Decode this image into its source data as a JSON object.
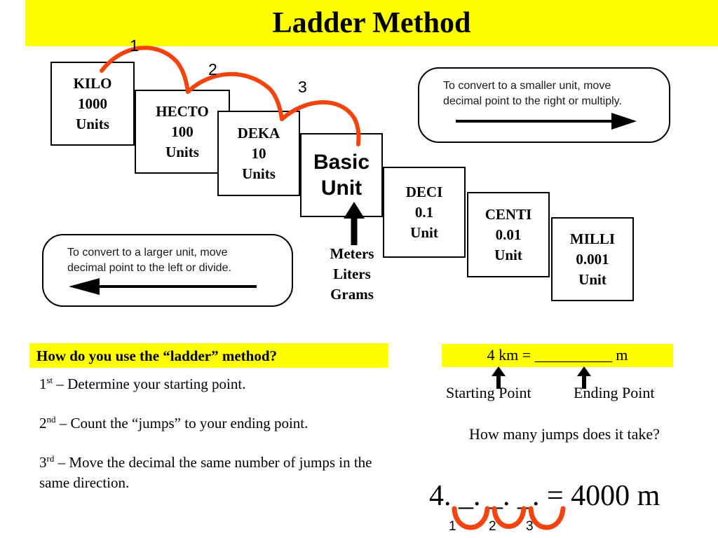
{
  "title": "Ladder Method",
  "colors": {
    "highlight": "#FFFF00",
    "jump_arc": "#F4430C",
    "text": "#000000",
    "background": "#FFFFFF"
  },
  "ladder": {
    "steps": [
      {
        "name": "KILO",
        "value": "1000",
        "unit": "Units"
      },
      {
        "name": "HECTO",
        "value": "100",
        "unit": "Units"
      },
      {
        "name": "DEKA",
        "value": "10",
        "unit": "Units"
      },
      {
        "name": "Basic",
        "value": "Unit",
        "unit": ""
      },
      {
        "name": "DECI",
        "value": "0.1",
        "unit": "Unit"
      },
      {
        "name": "CENTI",
        "value": "0.01",
        "unit": "Unit"
      },
      {
        "name": "MILLI",
        "value": "0.001",
        "unit": "Unit"
      }
    ],
    "jump_labels": [
      "1",
      "2",
      "3"
    ],
    "basic_unit_caption": [
      "Meters",
      "Liters",
      "Grams"
    ]
  },
  "callouts": {
    "smaller": {
      "line1": "To convert to a smaller unit, move",
      "line2": "decimal  point to the right or multiply.",
      "arrow": "arrow-right"
    },
    "larger": {
      "line1": "To convert to a larger unit, move",
      "line2": "decimal  point to the left or divide.",
      "arrow": "arrow-left"
    }
  },
  "howto": {
    "heading": "How do you use the “ladder” method?",
    "steps": [
      {
        "ordinal": "1",
        "suffix": "st",
        "text": " – Determine your starting point."
      },
      {
        "ordinal": "2",
        "suffix": "nd",
        "text": " – Count the “jumps” to your ending point."
      },
      {
        "ordinal": "3",
        "suffix": "rd",
        "text": " – Move the decimal the same number of jumps in the same direction."
      }
    ]
  },
  "example": {
    "equation": "4 km = __________ m",
    "starting_point_label": "Starting Point",
    "ending_point_label": "Ending Point",
    "question": "How many jumps does it take?",
    "decimal_equation": "4. _. _. _. = 4000 m",
    "decimal_parts": {
      "number": "4.",
      "blank1": "_.",
      "blank2": "_.",
      "blank3": "_.",
      "result": " = 4000 m"
    },
    "arc_labels": [
      "1",
      "2",
      "3"
    ]
  }
}
